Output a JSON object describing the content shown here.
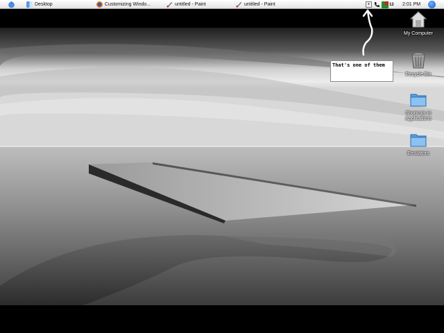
{
  "taskbar": {
    "tasks": [
      {
        "label": "Desktop",
        "icon": "finder-icon"
      },
      {
        "label": "Customizing Windo...",
        "icon": "firefox-icon"
      },
      {
        "label": "untitled - Paint",
        "icon": "paint-icon"
      },
      {
        "label": "untitled - Paint",
        "icon": "paint-icon"
      }
    ],
    "tray": {
      "add_label": "+",
      "cpu_value": "12",
      "clock": "2:01 PM"
    }
  },
  "desktop": {
    "icons": [
      {
        "label": "My Computer",
        "icon": "computer-icon"
      },
      {
        "label": "Recycle Bin",
        "icon": "recycle-bin-icon"
      },
      {
        "label": "Shortcuts to Applications",
        "icon": "folder-icon"
      },
      {
        "label": "Emulators",
        "icon": "folder-icon"
      }
    ],
    "annotation": "That's one of them"
  },
  "colors": {
    "taskbar": "#e8e8e8",
    "folder": "#7fb6ec",
    "search": "#1f6fdc"
  }
}
